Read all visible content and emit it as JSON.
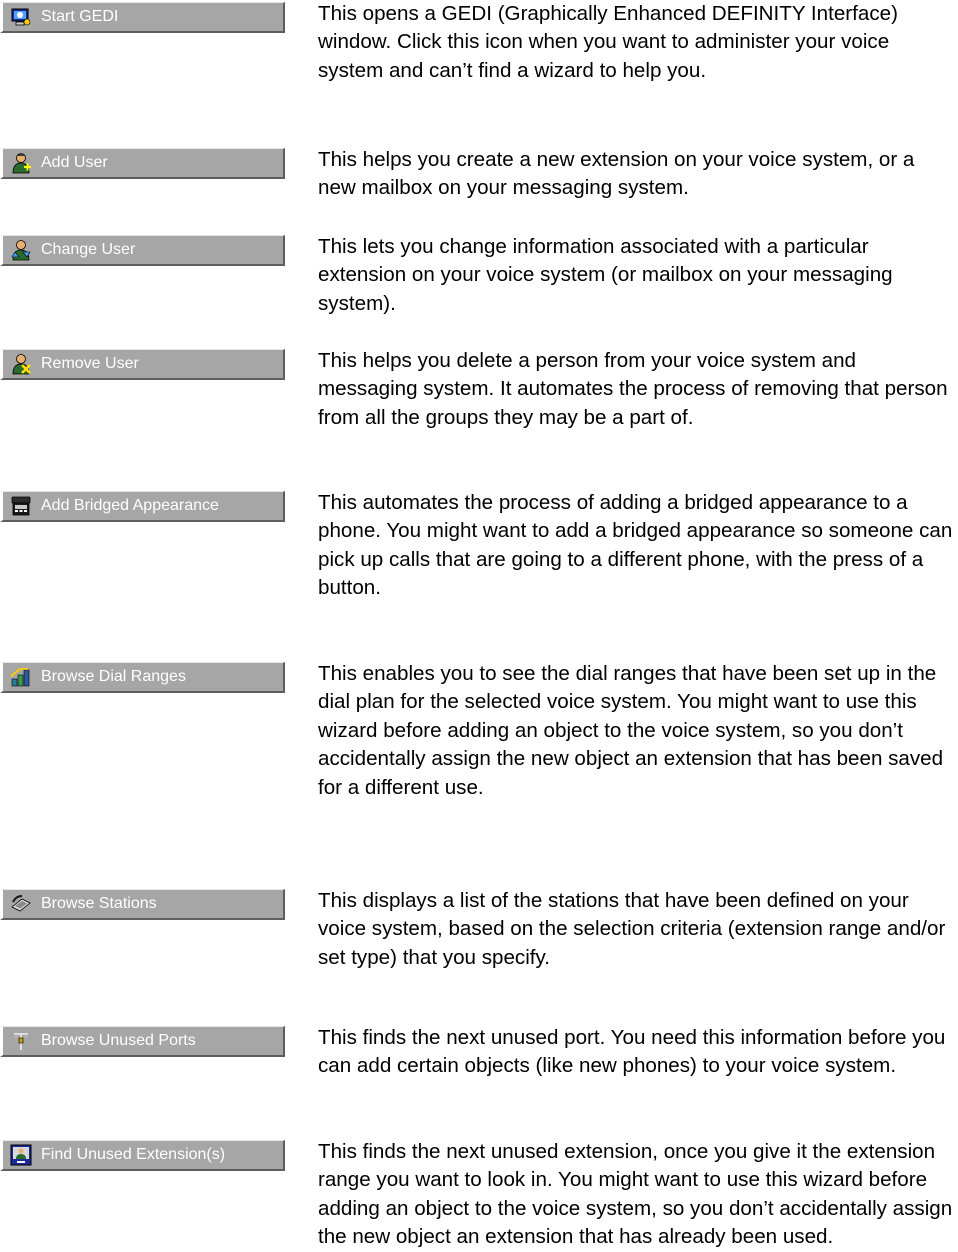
{
  "items": [
    {
      "label": "Start GEDI",
      "icon": "gedi-window-icon",
      "description": "This opens a GEDI (Graphically Enhanced DEFINITY Interface) window. Click this icon when you want to administer your voice system and can’t find a wizard to help you."
    },
    {
      "label": "Add User",
      "icon": "add-user-icon",
      "description": "This helps you create a new extension on your voice system, or a new mailbox on your messaging system."
    },
    {
      "label": "Change User",
      "icon": "change-user-icon",
      "description": "This lets you change information associated with a particular extension on your voice system (or mailbox on your messaging system)."
    },
    {
      "label": "Remove User",
      "icon": "remove-user-icon",
      "description": "This helps you delete a person from your voice system and messaging system. It automates the process of removing that person from all the groups they may be a part of."
    },
    {
      "label": "Add Bridged Appearance",
      "icon": "phone-icon",
      "description": "This automates the process of adding a bridged appearance to a phone. You might want to add a bridged appearance so someone can pick up calls that are going to a different phone, with the press of a button."
    },
    {
      "label": "Browse Dial Ranges",
      "icon": "dial-ranges-icon",
      "description": "This enables you to see the dial ranges that have been set up in the dial plan for the selected voice system. You might want to use this wizard before adding an object to the voice system, so you don’t accidentally assign the new object an extension that has been saved for a different use."
    },
    {
      "label": "Browse Stations",
      "icon": "stations-icon",
      "description": "This displays a list of the stations that have been defined on your voice system, based on the selection criteria (extension range and/or set type) that you specify."
    },
    {
      "label": "Browse Unused Ports",
      "icon": "port-connector-icon",
      "description": "This finds the next unused port. You need this information before you can add certain objects (like new phones) to your voice system."
    },
    {
      "label": "Find Unused Extension(s)",
      "icon": "monitor-user-icon",
      "description": "This finds the next unused extension, once you give it the extension range you want to look in. You might want to use this wizard before adding an object to the voice system, so you don’t accidentally assign the new object an extension that has already been used."
    }
  ]
}
